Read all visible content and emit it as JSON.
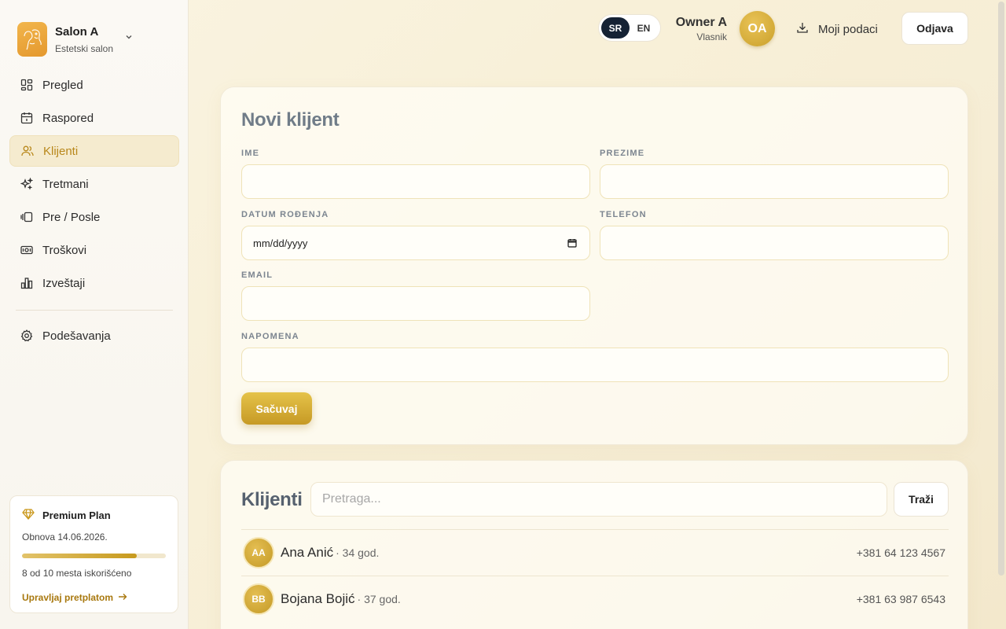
{
  "brand": {
    "name": "Salon A",
    "subtitle": "Estetski salon"
  },
  "nav": {
    "items": [
      {
        "label": "Pregled",
        "icon": "dashboard-icon"
      },
      {
        "label": "Raspored",
        "icon": "calendar-icon"
      },
      {
        "label": "Klijenti",
        "icon": "users-icon",
        "active": true
      },
      {
        "label": "Tretmani",
        "icon": "sparkles-icon"
      },
      {
        "label": "Pre / Posle",
        "icon": "before-after-icon"
      },
      {
        "label": "Troškovi",
        "icon": "cash-icon"
      },
      {
        "label": "Izveštaji",
        "icon": "bar-chart-icon"
      }
    ],
    "settings": {
      "label": "Podešavanja",
      "icon": "gear-icon"
    }
  },
  "plan": {
    "title": "Premium Plan",
    "renewal": "Obnova 14.06.2026.",
    "usage_used": 8,
    "usage_total": 10,
    "usage_text": "8 od 10 mesta iskorišćeno",
    "manage_label": "Upravljaj pretplatom"
  },
  "topbar": {
    "lang_sr": "SR",
    "lang_en": "EN",
    "active_lang": "SR",
    "user_name": "Owner A",
    "user_role": "Vlasnik",
    "user_initials": "OA",
    "export_label": "Moji podaci",
    "logout_label": "Odjava"
  },
  "form": {
    "title": "Novi klijent",
    "first_name_label": "IME",
    "last_name_label": "PREZIME",
    "birthdate_label": "DATUM ROĐENJA",
    "birthdate_placeholder": "mm/dd/yyyy",
    "phone_label": "TELEFON",
    "email_label": "EMAIL",
    "note_label": "NAPOMENA",
    "save_label": "Sačuvaj"
  },
  "clients": {
    "title": "Klijenti",
    "search_placeholder": "Pretraga...",
    "search_button": "Traži",
    "rows": [
      {
        "initials": "AA",
        "name": "Ana Anić",
        "age": "· 34 god.",
        "phone": "+381 64 123 4567"
      },
      {
        "initials": "BB",
        "name": "Bojana Bojić",
        "age": "· 37 god.",
        "phone": "+381 63 987 6543"
      }
    ]
  },
  "colors": {
    "accent": "#c79a1d",
    "active_nav_bg": "#f5ebcf",
    "dark_pill": "#152234"
  }
}
